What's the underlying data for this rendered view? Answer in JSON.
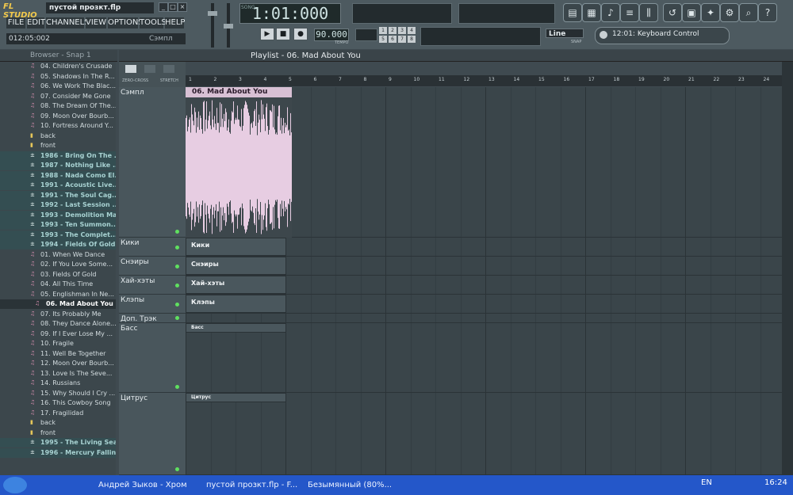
{
  "app": {
    "logo": "FL STUDIO",
    "project_title": "пустой прозкт.flp",
    "menus": [
      "FILE",
      "EDIT",
      "CHANNELS",
      "VIEW",
      "OPTIONS",
      "TOOLS",
      "HELP"
    ],
    "hint_time": "012:05:002",
    "hint_label": "Сэмпл"
  },
  "transport": {
    "time_display": "1:01:000",
    "time_mode": "SONG",
    "tempo": "90.000",
    "tempo_label": "TEMPO",
    "snap_value": "Line",
    "snap_label": "SNAP",
    "hint_bar": "12:01: Keyboard Control"
  },
  "browser": {
    "title": "Browser - Snap 1",
    "items": [
      {
        "label": "04. Children's Crusade",
        "kind": "file"
      },
      {
        "label": "05. Shadows In The R...",
        "kind": "file"
      },
      {
        "label": "06. We Work The Blac...",
        "kind": "file"
      },
      {
        "label": "07. Consider Me Gone",
        "kind": "file"
      },
      {
        "label": "08. The Dream Of The...",
        "kind": "file"
      },
      {
        "label": "09. Moon Over Bourb...",
        "kind": "file"
      },
      {
        "label": "10. Fortress Around Y...",
        "kind": "file"
      },
      {
        "label": "back",
        "kind": "folder"
      },
      {
        "label": "front",
        "kind": "folder"
      },
      {
        "label": "1986 - Bring On The ...",
        "kind": "group"
      },
      {
        "label": "1987 - Nothing Like ...",
        "kind": "group"
      },
      {
        "label": "1988 - Nada Como El...",
        "kind": "group"
      },
      {
        "label": "1991 - Acoustic Live...",
        "kind": "group"
      },
      {
        "label": "1991 - The Soul Cag...",
        "kind": "group"
      },
      {
        "label": "1992 - Last Session ...",
        "kind": "group"
      },
      {
        "label": "1993 - Demolition Man",
        "kind": "group"
      },
      {
        "label": "1993 - Ten Summon...",
        "kind": "group"
      },
      {
        "label": "1993 - The Complet...",
        "kind": "group"
      },
      {
        "label": "1994 - Fields Of Gold",
        "kind": "group"
      },
      {
        "label": "01. When We Dance",
        "kind": "file"
      },
      {
        "label": "02. If You Love Some...",
        "kind": "file"
      },
      {
        "label": "03. Fields Of Gold",
        "kind": "file"
      },
      {
        "label": "04. All This Time",
        "kind": "file"
      },
      {
        "label": "05. Englishman In Ne...",
        "kind": "file"
      },
      {
        "label": "06. Mad About You",
        "kind": "selected"
      },
      {
        "label": "07. Its Probably Me",
        "kind": "file"
      },
      {
        "label": "08. They Dance Alone...",
        "kind": "file"
      },
      {
        "label": "09. If I Ever Lose My ...",
        "kind": "file"
      },
      {
        "label": "10. Fragile",
        "kind": "file"
      },
      {
        "label": "11. Well Be Together",
        "kind": "file"
      },
      {
        "label": "12. Moon Over Bourb...",
        "kind": "file"
      },
      {
        "label": "13. Love Is The Seve...",
        "kind": "file"
      },
      {
        "label": "14. Russians",
        "kind": "file"
      },
      {
        "label": "15. Why Should I Cry ...",
        "kind": "file"
      },
      {
        "label": "16. This Cowboy Song",
        "kind": "file"
      },
      {
        "label": "17. Fragilidad",
        "kind": "file"
      },
      {
        "label": "back",
        "kind": "folder"
      },
      {
        "label": "front",
        "kind": "folder"
      },
      {
        "label": "1995 - The Living Sea",
        "kind": "group"
      },
      {
        "label": "1996 - Mercury Falling",
        "kind": "group"
      }
    ]
  },
  "playlist": {
    "title": "Playlist - 06. Mad About You",
    "options": [
      "ZERO-CROSS",
      "STRETCH"
    ],
    "ruler": [
      "1",
      "2",
      "3",
      "4",
      "5",
      "6",
      "7",
      "8",
      "9",
      "10",
      "11",
      "12",
      "13",
      "14",
      "15",
      "16",
      "17",
      "18",
      "19",
      "20",
      "21",
      "22",
      "23",
      "24"
    ],
    "tracks": [
      {
        "name": "Сэмпл",
        "clip": "06. Mad About You"
      },
      {
        "name": "Кики",
        "clip": "Кики"
      },
      {
        "name": "Снэиры",
        "clip": "Снэиры"
      },
      {
        "name": "Хай-хэты",
        "clip": "Хай-хэты"
      },
      {
        "name": "Клэпы",
        "clip": "Клэпы"
      },
      {
        "name": "Доп. Трэк",
        "clip": ""
      },
      {
        "name": "Басс",
        "clip": "Басс"
      },
      {
        "name": "Цитрус",
        "clip": "Цитрус"
      }
    ]
  },
  "taskbar": {
    "tasks": [
      "Андрей Зыков - Хром",
      "пустой прозкт.flp - F...",
      "Безымянный (80%..."
    ],
    "lang": "EN",
    "clock": "16:24"
  }
}
